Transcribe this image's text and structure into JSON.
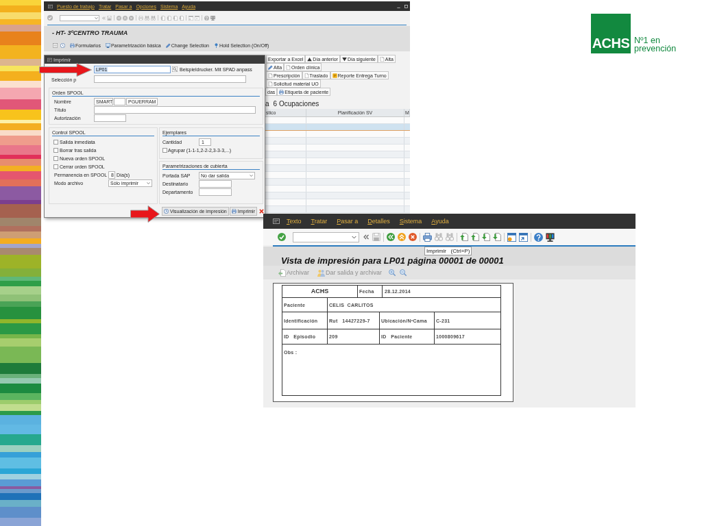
{
  "logo": {
    "mark": "ACHS",
    "tagline": [
      "Nº1 en",
      "prevención"
    ]
  },
  "main_window": {
    "menu": [
      "Puesto de trabajo",
      "Tratar",
      "Pasar a",
      "Opciones",
      "Sistema",
      "Ayuda"
    ],
    "title": "- HT- 3ºCENTRO TRAUMA",
    "app_toolbar": [
      "Formularios",
      "Parametrización básica",
      "Change Selection",
      "Hold Selection (On/Off)"
    ],
    "button_rows": [
      [
        "Exportar a Excel",
        "Día anterior",
        "Día siguiente",
        "Alta",
        "Alta",
        "Orden clínica"
      ],
      [
        "Prescripción",
        "Traslado",
        "Reporte Entrega Turno",
        "Solicitud material UO"
      ],
      [
        "das",
        "Etiqueta de paciente"
      ]
    ],
    "heading_prefix": "a",
    "heading": "6 Ocupaciones",
    "table": {
      "columns": [
        "stico",
        "Planificación SV",
        "M"
      ],
      "rows": [
        {
          "selected": false
        },
        {
          "selected": true
        },
        {
          "selected": false
        },
        {
          "selected": false
        },
        {
          "selected": false
        },
        {
          "selected": false
        },
        {
          "selected": false
        },
        {
          "selected": false
        },
        {
          "selected": false
        },
        {
          "selected": false
        },
        {
          "selected": false
        },
        {
          "selected": false
        },
        {
          "selected": false
        },
        {
          "selected": false
        }
      ]
    }
  },
  "print_dialog": {
    "title": "Imprimir",
    "output_device": {
      "value": "LP01",
      "description": "Beispieldrucker. Mit SPAD anpass"
    },
    "page_selection": {
      "label": "Selección p"
    },
    "spool_order": {
      "title": "Orden SPOOL",
      "name": {
        "label": "Nombre",
        "values": [
          "SMART",
          "PGUERRAM"
        ]
      },
      "fields": [
        {
          "label": "Título"
        },
        {
          "label": "Autorización"
        }
      ]
    },
    "spool_control": {
      "title": "Control SPOOL",
      "options": [
        {
          "label": "Salida inmediata",
          "checked": false
        },
        {
          "label": "Borrar tras salida",
          "checked": false
        },
        {
          "label": "Nueva orden SPOOL",
          "checked": false
        },
        {
          "label": "Cerrar orden SPOOL",
          "checked": false
        }
      ],
      "retention": {
        "label": "Permanencia en SPOOL",
        "value": "8",
        "unit": "Día(s)"
      },
      "archive_mode": {
        "label": "Modo archivo",
        "value": "Sólo imprimir"
      }
    },
    "copies": {
      "title": "Ejemplares",
      "quantity": {
        "label": "Cantidad",
        "value": "1"
      },
      "collate": {
        "label": "Agrupar (1-1-1,2-2-2,3-3-3,...)",
        "checked": false
      }
    },
    "cover": {
      "title": "Parametrizaciones de cubierta",
      "fields": [
        {
          "kind": "select",
          "label": "Portada SAP",
          "value": "No dar salida"
        },
        {
          "kind": "input",
          "label": "Destinatario"
        },
        {
          "kind": "input",
          "label": "Departamento"
        }
      ]
    },
    "buttons": [
      {
        "kind": "preview",
        "label": "Visualización de impresión"
      },
      {
        "kind": "print",
        "label": "Imprimir"
      },
      {
        "kind": "close"
      }
    ]
  },
  "preview_window": {
    "menu": [
      "Texto",
      "Tratar",
      "Pasar a",
      "Detalles",
      "Sistema",
      "Ayuda"
    ],
    "tooltip": "Imprimir   (Ctrl+P)",
    "title": "Vista de impresión para LP01 página 00001 de 00001",
    "actions": [
      {
        "label": "Archivar",
        "disabled": true
      },
      {
        "label": "Dar salida y archivar",
        "disabled": true
      }
    ],
    "document": {
      "header": {
        "brand": "ACHS",
        "date_label": "Fecha",
        "date": "28.12.2014"
      },
      "rows": [
        [
          "Paciente",
          "CELIS  CARLITOS"
        ],
        [
          "Identificación",
          "Rut   14427229-7",
          "Ubicación/NºCama",
          "C-231"
        ],
        [
          "ID   Episodio",
          "209",
          "ID   Paciente",
          "1000809617"
        ],
        [
          "Obs :"
        ]
      ]
    }
  }
}
